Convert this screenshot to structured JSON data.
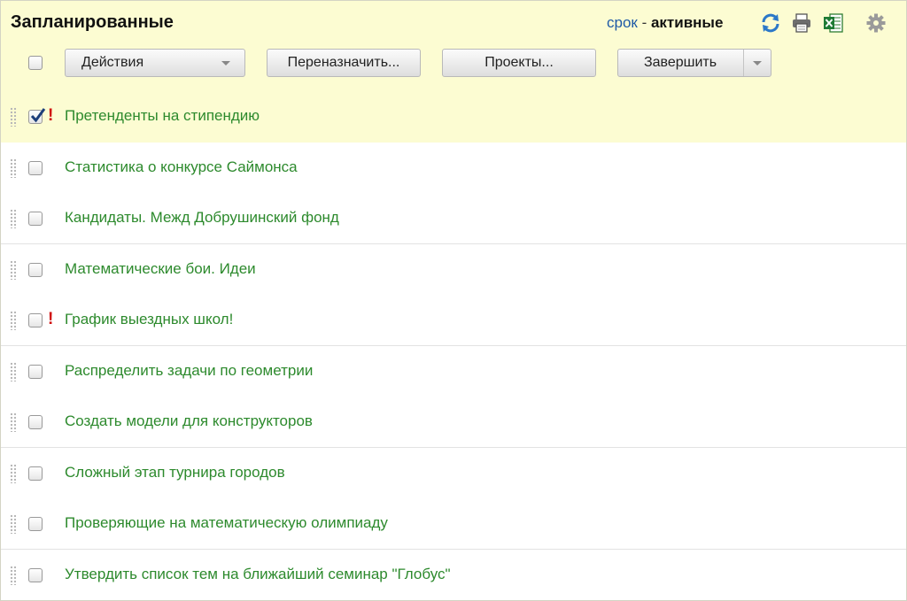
{
  "header": {
    "title": "Запланированные",
    "filter": {
      "sort_link": "срок",
      "separator": " - ",
      "state": "активные"
    },
    "icons": [
      "refresh-icon",
      "print-icon",
      "excel-export-icon",
      "settings-gear-icon"
    ]
  },
  "toolbar": {
    "actions_label": "Действия",
    "reassign_label": "Переназначить...",
    "projects_label": "Проекты...",
    "complete_label": "Завершить"
  },
  "tasks": [
    {
      "title": "Претенденты на стипендию",
      "checked": true,
      "important": true,
      "important_mark": "!"
    },
    {
      "title": "Статистика о конкурсе Саймонса",
      "checked": false,
      "important": false
    },
    {
      "title": "Кандидаты. Межд Добрушинский фонд",
      "checked": false,
      "important": false
    },
    {
      "title": "Математические бои. Идеи",
      "checked": false,
      "important": false
    },
    {
      "title": "График выездных школ!",
      "checked": false,
      "important": true,
      "important_mark": "!"
    },
    {
      "title": "Распределить задачи по геометрии",
      "checked": false,
      "important": false
    },
    {
      "title": "Создать модели для конструкторов",
      "checked": false,
      "important": false
    },
    {
      "title": "Сложный этап турнира городов",
      "checked": false,
      "important": false
    },
    {
      "title": "Проверяющие на математическую олимпиаду",
      "checked": false,
      "important": false
    },
    {
      "title": "Утвердить список тем на ближайший семинар \"Глобус\"",
      "checked": false,
      "important": false
    }
  ],
  "colors": {
    "header_bg": "#fcfcd2",
    "task_text": "#2d8a2d",
    "link": "#1f5aa6",
    "important": "#d01010"
  }
}
